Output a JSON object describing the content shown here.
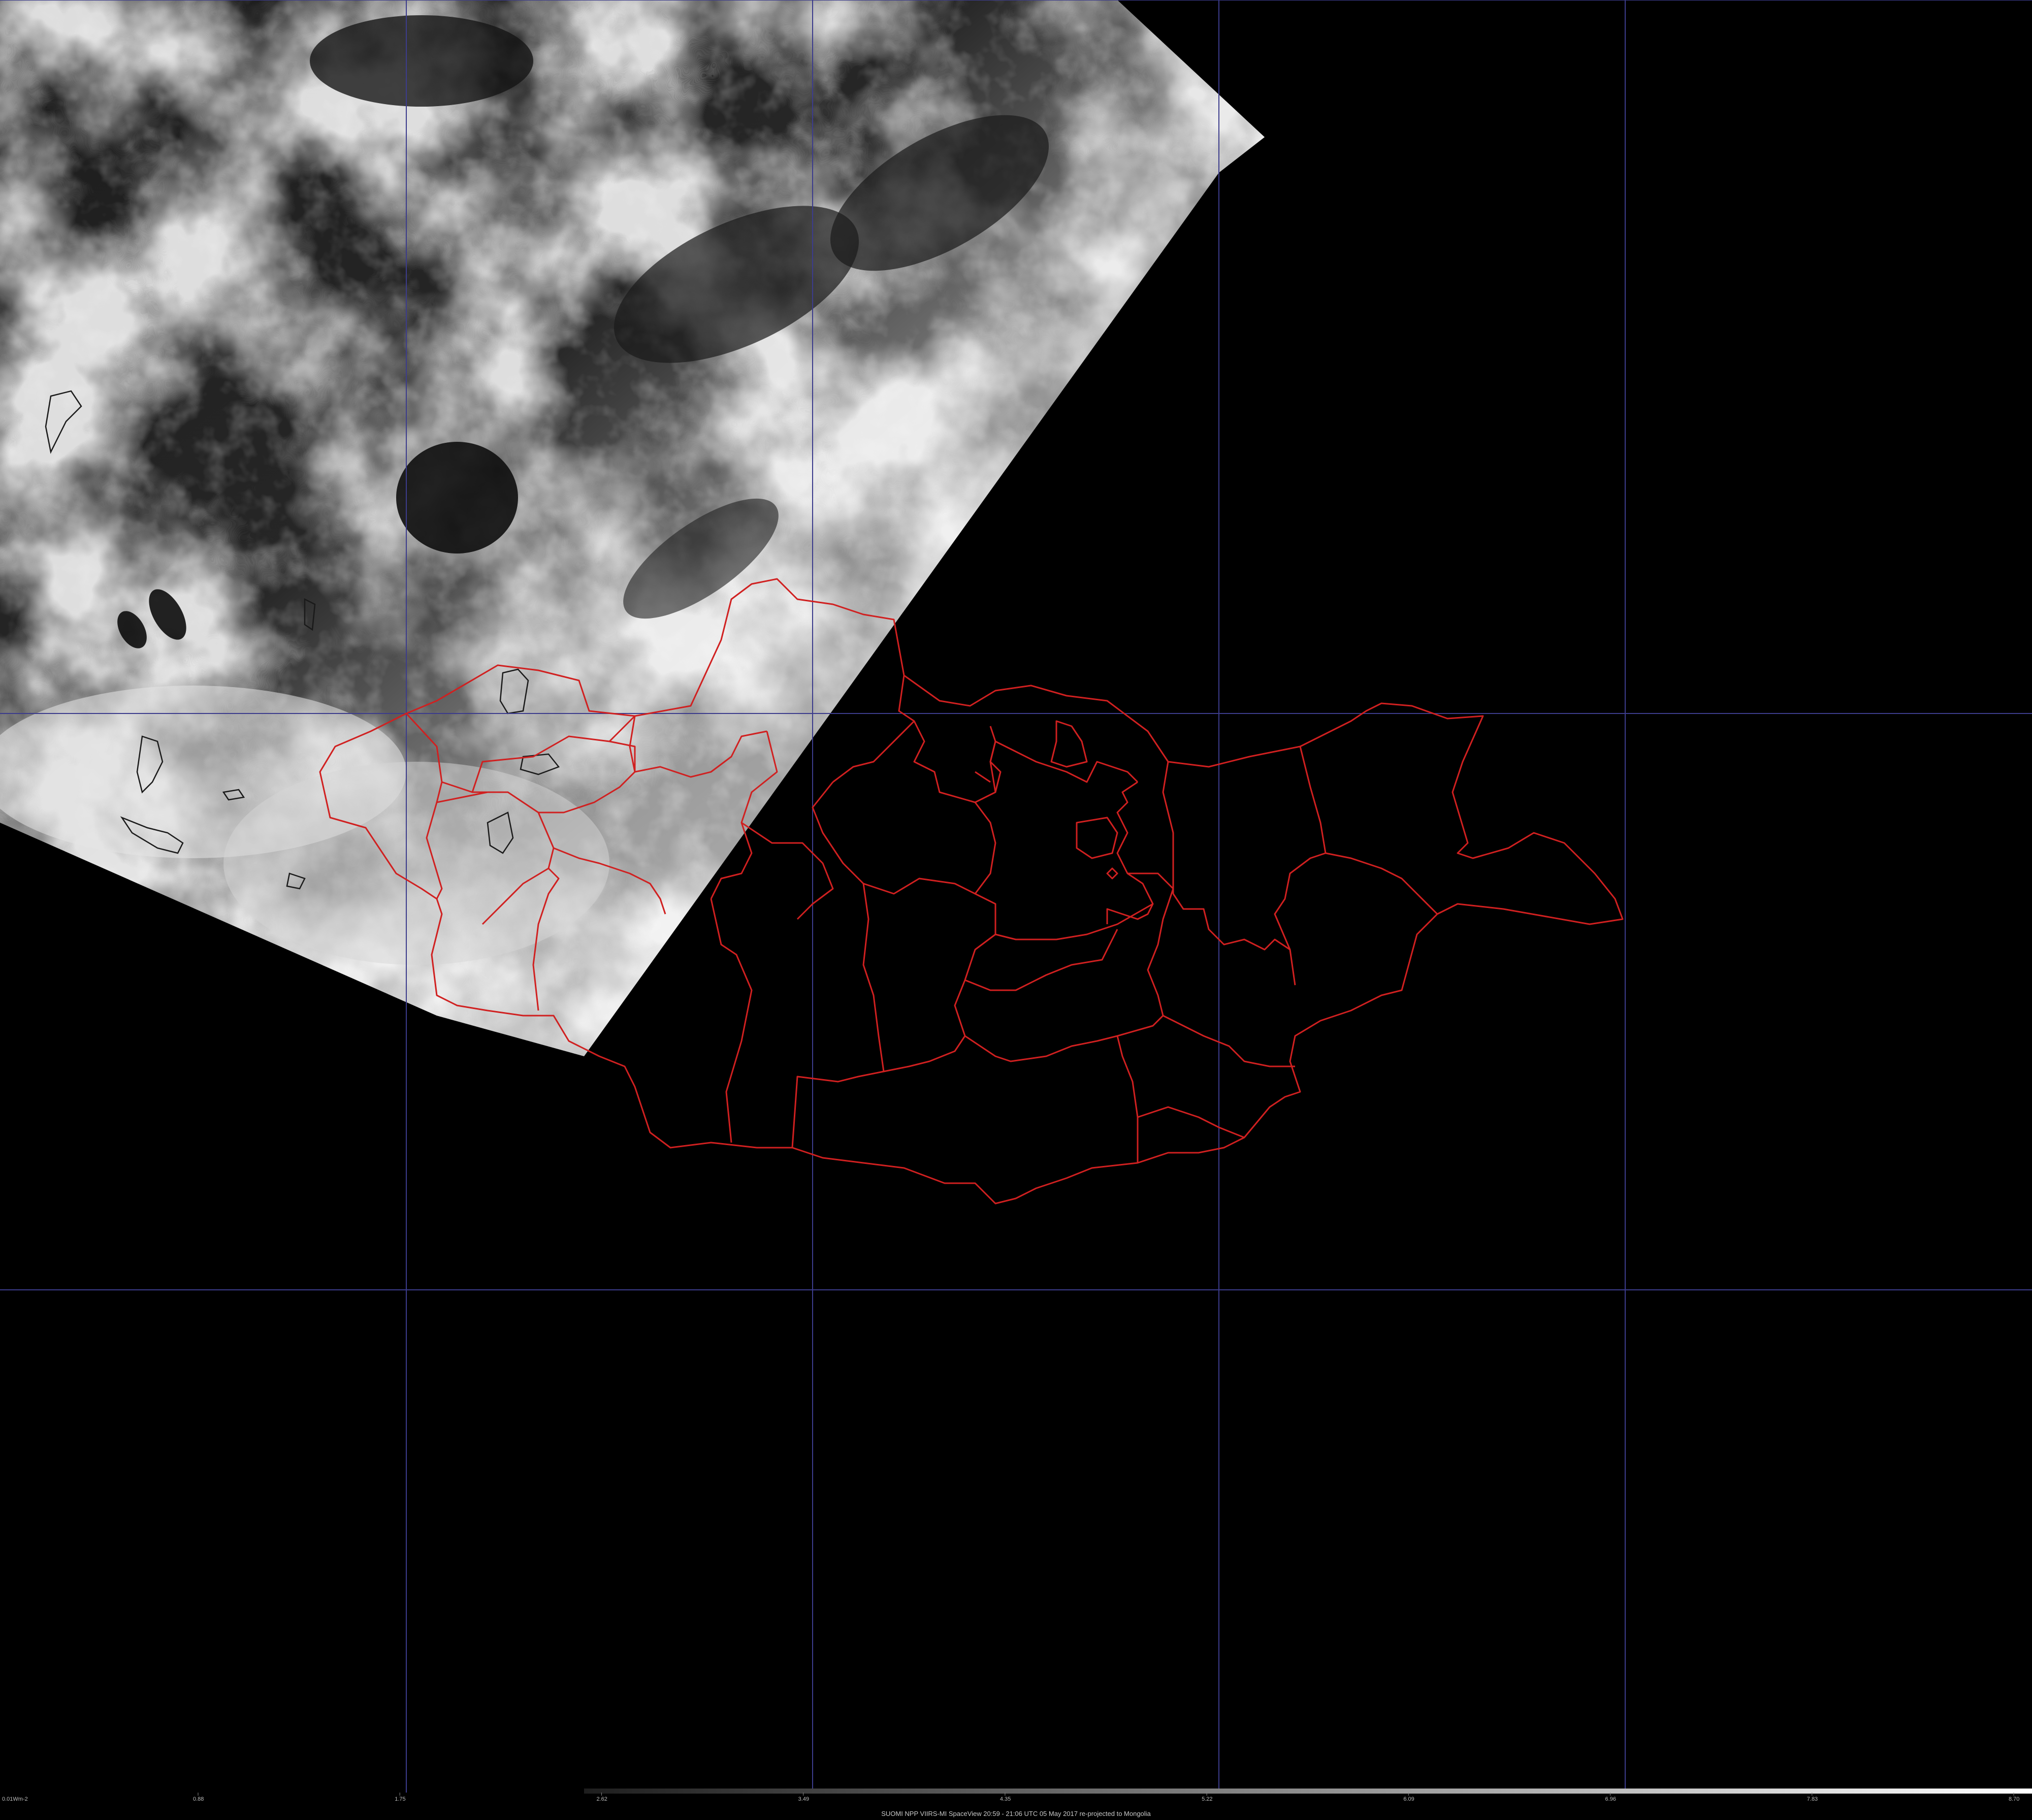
{
  "image": {
    "caption": "SUOMI NPP VIIRS-MI SpaceView 20:59 - 21:06 UTC 05 May 2017 re-projected to Mongolia"
  },
  "colors": {
    "background": "#000000",
    "graticule": "#3c3c8c",
    "admin_borders": "#d02020",
    "lake_outlines": "#1a1a1a",
    "colorbar_low": "#1e1e1e",
    "colorbar_high": "#ffffff"
  },
  "graticule": {
    "visible": true
  },
  "layers": {
    "satellite_swath": "grayscale visible imagery, cloud cover",
    "borders": "Mongolia aimag (province) boundaries"
  },
  "colorbar": {
    "unit_label": "0.01Wm-2",
    "ticks": [
      "0.88",
      "1.75",
      "2.62",
      "3.49",
      "4.35",
      "5.22",
      "6.09",
      "6.96",
      "7.83",
      "8.70"
    ]
  }
}
